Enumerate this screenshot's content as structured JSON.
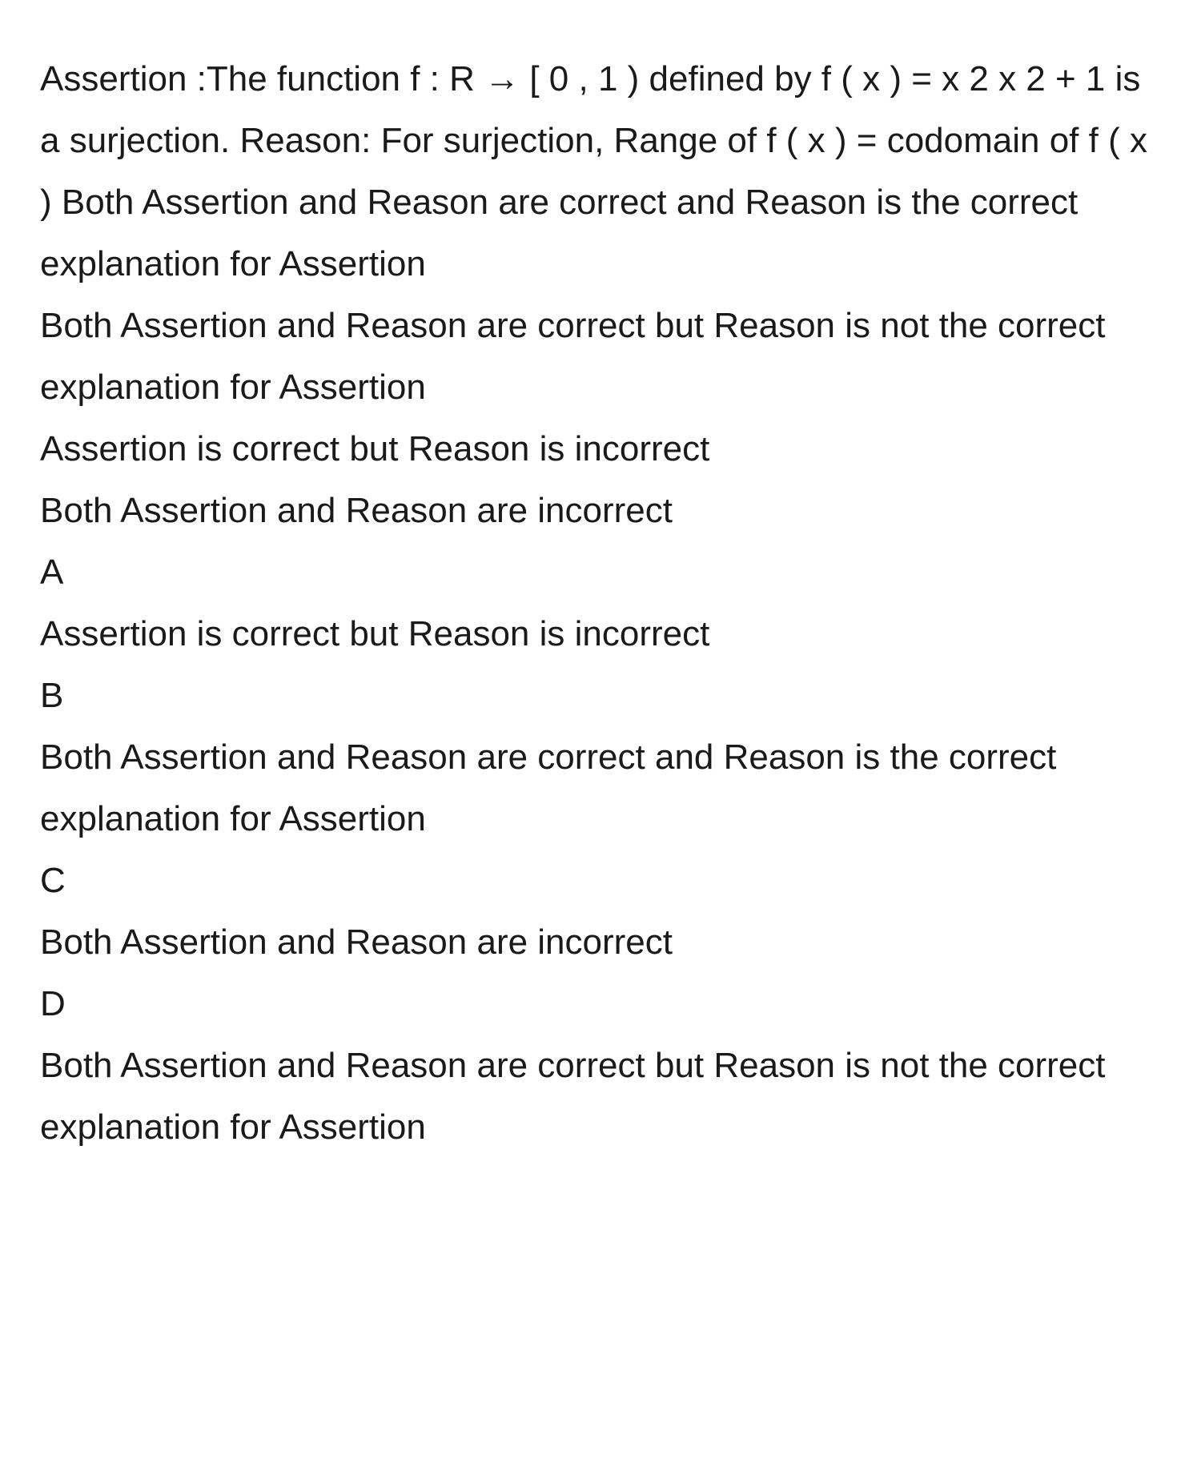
{
  "question": {
    "main_text": "Assertion :The function f : R → [ 0 , 1 ) defined by f ( x ) = x 2 x 2 + 1 is a surjection. Reason: For surjection, Range of f ( x ) = codomain of f ( x ) Both Assertion and Reason are correct and Reason is the correct explanation for Assertion",
    "line2": "Both Assertion and Reason are correct but Reason is not the correct explanation for Assertion",
    "line3": "Assertion is correct but Reason is incorrect",
    "line4": "Both Assertion and Reason are incorrect"
  },
  "options": {
    "a": {
      "label": "A",
      "text": "Assertion is correct but Reason is incorrect"
    },
    "b": {
      "label": "B",
      "text": "Both Assertion and Reason are correct and Reason is the correct explanation for Assertion"
    },
    "c": {
      "label": "C",
      "text": "Both Assertion and Reason are incorrect"
    },
    "d": {
      "label": "D",
      "text": "Both Assertion and Reason are correct but Reason is not the correct explanation for Assertion"
    }
  }
}
